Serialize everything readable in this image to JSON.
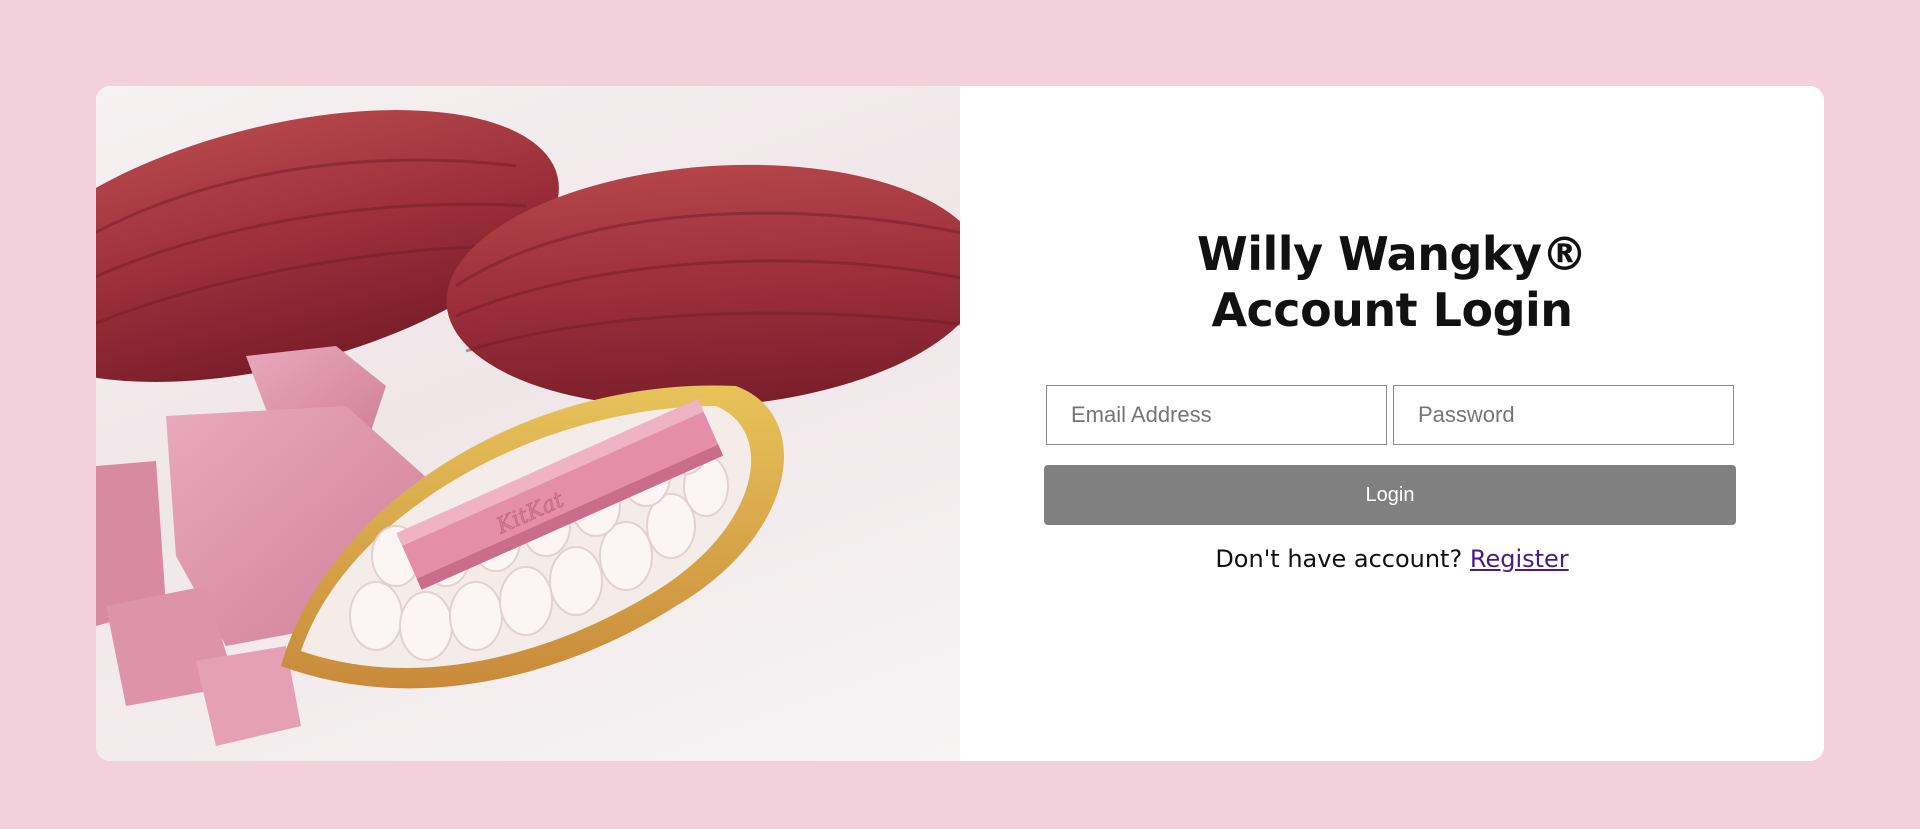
{
  "login": {
    "title_line1": "Willy Wangky®",
    "title_line2": "Account Login",
    "email_placeholder": "Email Address",
    "password_placeholder": "Password",
    "login_label": "Login",
    "register_prompt": "Don't have account?",
    "register_label": "Register"
  },
  "colors": {
    "page_background": "#f2d1dc",
    "card_background": "#ffffff",
    "button_background": "#808080",
    "link": "#4b1a8a"
  },
  "hero_image": {
    "icon": "cocoa-pods-ruby-chocolate-image",
    "logo_text": "KitKat"
  }
}
